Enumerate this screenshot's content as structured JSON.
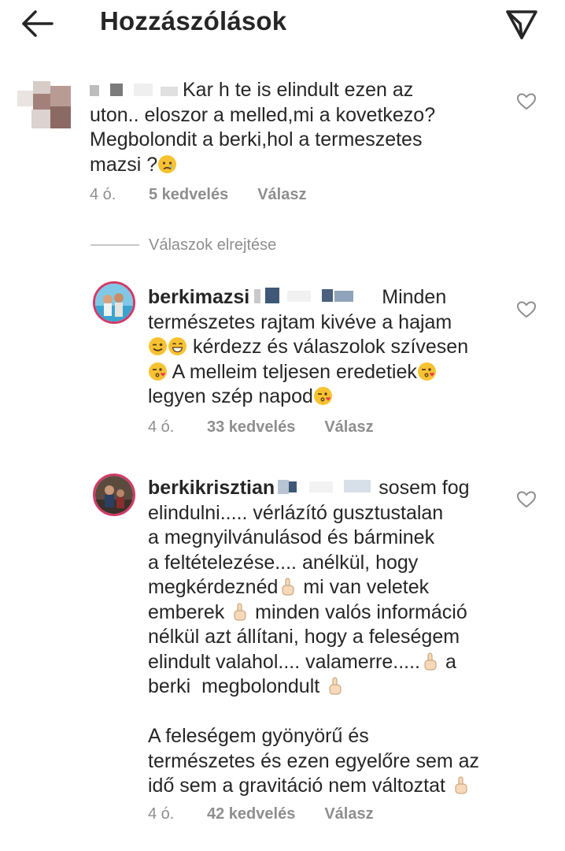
{
  "header": {
    "title": "Hozzászólások",
    "back_icon": "arrow-left-icon",
    "send_icon": "paper-plane-icon"
  },
  "colors": {
    "text": "#262626",
    "secondary": "#8e8e8e",
    "story_ring": "#d13a66"
  },
  "comments": [
    {
      "username": "",
      "lines": [
        "Kar h te is elindult ezen az",
        "uton.. eloszor a melled,mi a kovetkezo?",
        "Megbolondit a berki,hol a termeszetes",
        "mazsi ?"
      ],
      "emoji": "crying-face-emoji",
      "time": "4 ó.",
      "likes": "5 kedvelés",
      "reply": "Válasz"
    }
  ],
  "hide_replies": "Válaszok elrejtése",
  "replies": [
    {
      "username": "berkimazsi",
      "lines": [
        "Minden",
        "természetes rajtam kivéve a hajam",
        "kérdezz és válaszolok szívesen",
        "A melleim teljesen eredetiek",
        "legyen szép napod"
      ],
      "time": "4 ó.",
      "likes": "33 kedvelés",
      "reply": "Válasz"
    },
    {
      "username": "berkikrisztian",
      "lines": [
        "sosem fog",
        "elindulni..... vérlázító gusztustalan",
        "a megnyilvánulásod és bárminek",
        "a feltételezése.... anélkül, hogy",
        "megkérdeznéd",
        "mi van veletek",
        "emberek",
        "minden valós információ",
        "nélkül azt állítani, hogy a feleségem",
        "elindult valahol.... valamerre.....",
        "a",
        "berki  megbolondult",
        "A feleségem gyönyörű és",
        "természetes és ezen egyelőre sem az",
        "idő sem a gravitáció nem változtat"
      ],
      "time": "4 ó.",
      "likes": "42 kedvelés",
      "reply": "Válasz"
    }
  ]
}
